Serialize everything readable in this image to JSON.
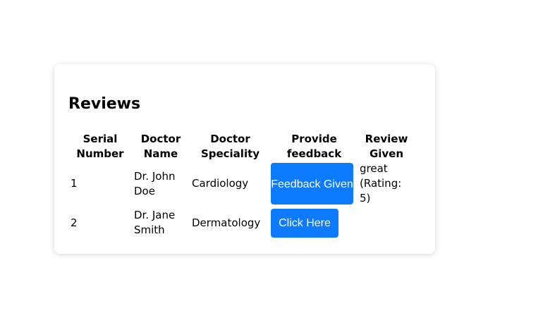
{
  "reviews": {
    "title": "Reviews",
    "columns": [
      "Serial Number",
      "Doctor Name",
      "Doctor Speciality",
      "Provide feedback",
      "Review Given"
    ],
    "rows": [
      {
        "serial": "1",
        "doctor": "Dr. John Doe",
        "speciality": "Cardiology",
        "feedback_button": "Feedback Given",
        "review": "great (Rating: 5)"
      },
      {
        "serial": "2",
        "doctor": "Dr. Jane Smith",
        "speciality": "Dermatology",
        "feedback_button": "Click Here",
        "review": ""
      }
    ]
  },
  "colors": {
    "button_bg": "#0d7bff",
    "button_text": "#ffffff",
    "card_bg": "#ffffff"
  }
}
